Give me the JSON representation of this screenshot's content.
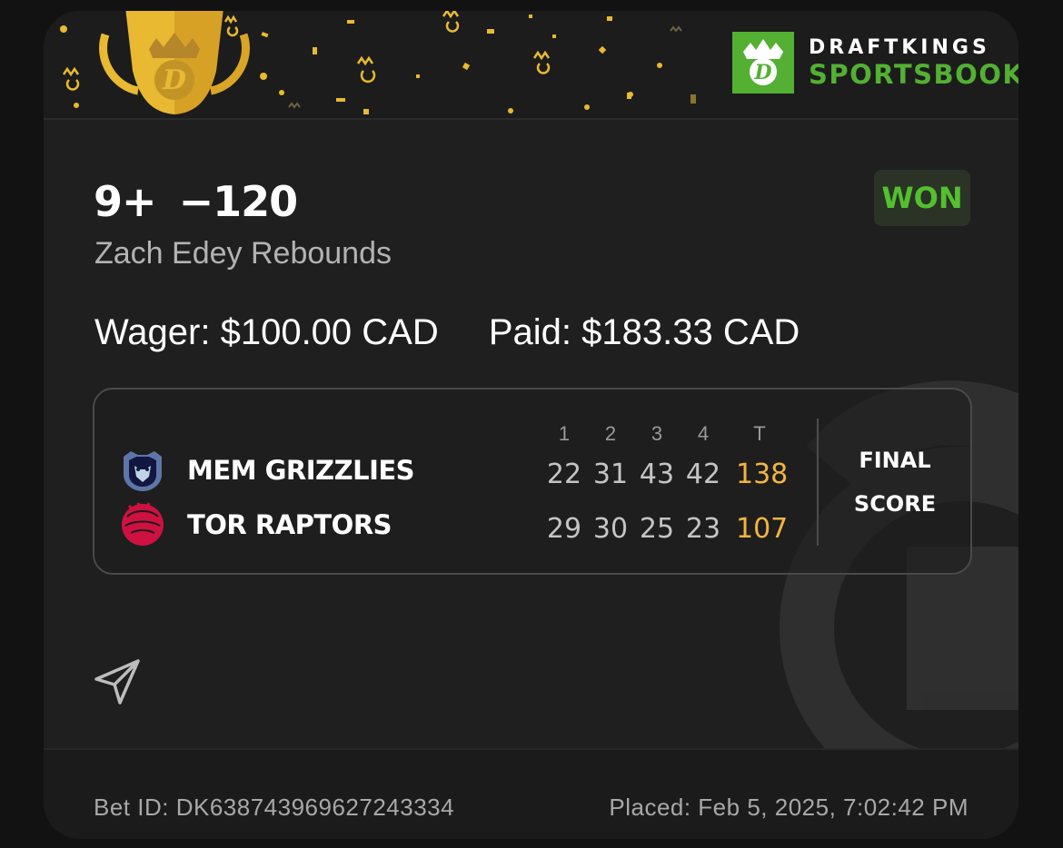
{
  "brand": {
    "line1": "DRAFTKINGS",
    "line2": "SPORTSBOOK",
    "logo_icon": "draftkings-crown-d-icon",
    "color": "#53b033"
  },
  "bet": {
    "selection": "9+",
    "odds": "−120",
    "status": "WON",
    "market": "Zach Edey Rebounds",
    "wager_label": "Wager:",
    "wager_value": "$100.00 CAD",
    "paid_label": "Paid:",
    "paid_value": "$183.33 CAD"
  },
  "scoreboard": {
    "periods": [
      "1",
      "2",
      "3",
      "4",
      "T"
    ],
    "teams": [
      {
        "name": "MEM GRIZZLIES",
        "icon": "grizzlies-logo-icon",
        "scores": [
          "22",
          "31",
          "43",
          "42"
        ],
        "total": "138"
      },
      {
        "name": "TOR RAPTORS",
        "icon": "raptors-logo-icon",
        "scores": [
          "29",
          "30",
          "25",
          "23"
        ],
        "total": "107"
      }
    ],
    "final_line1": "FINAL",
    "final_line2": "SCORE",
    "total_color": "#f2b541"
  },
  "footer": {
    "bet_id": "Bet ID: DK638743969627243334",
    "placed": "Placed: Feb 5, 2025, 7:02:42 PM"
  },
  "icons": {
    "share": "share-send-icon",
    "trophy": "trophy-icon"
  }
}
